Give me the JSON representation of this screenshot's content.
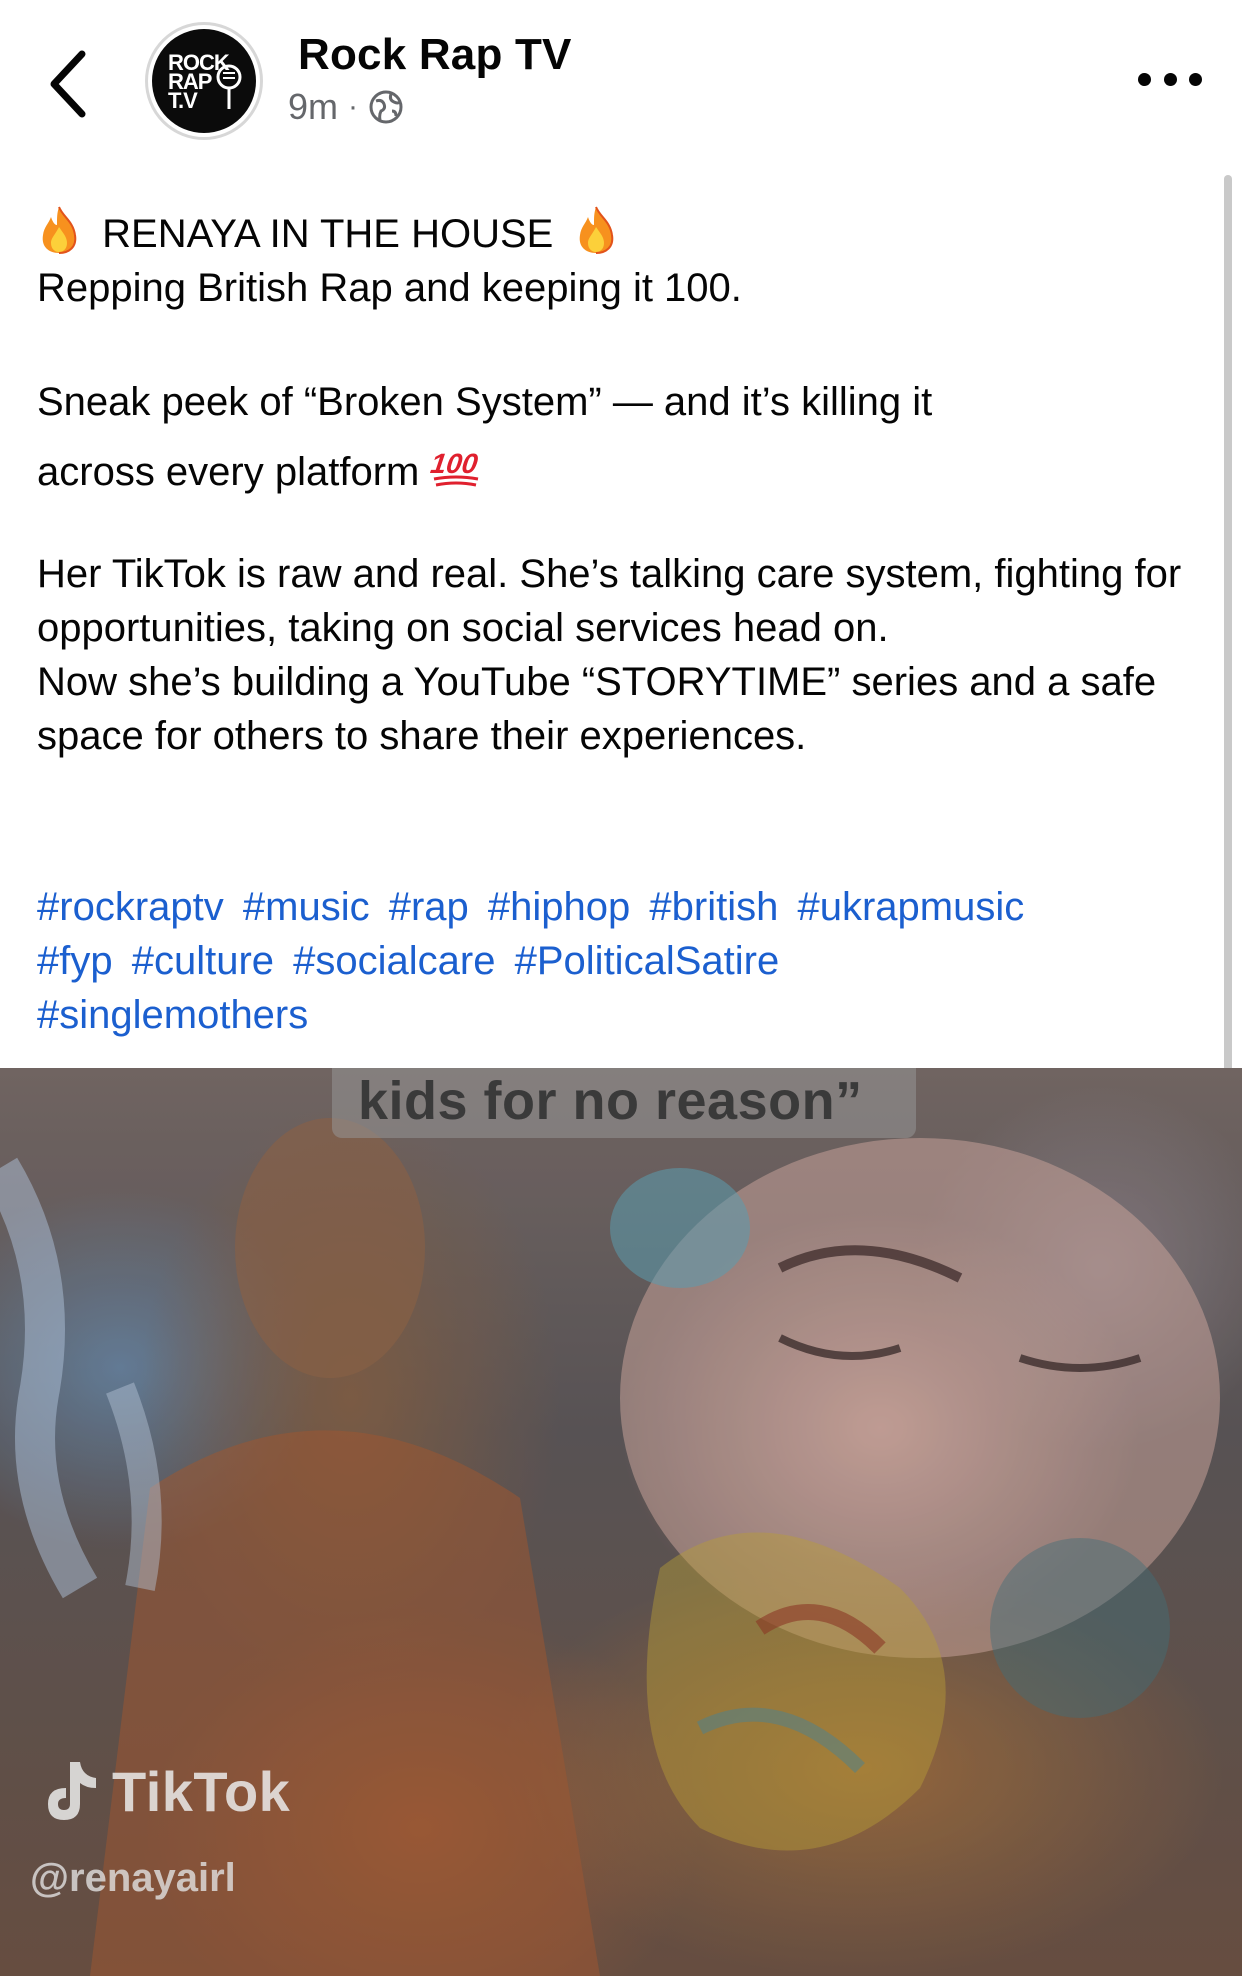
{
  "header": {
    "page_name": "Rock Rap TV",
    "time": "9m",
    "separator": "·",
    "avatar_lines": [
      "ROCK",
      "RAP",
      "T.V"
    ]
  },
  "post": {
    "line1": "RENAYA IN THE HOUSE",
    "line2": "Repping British Rap and keeping it 100.",
    "line3": "Sneak peek of “Broken System” — and it’s killing it",
    "line4": "across every platform",
    "line5": "Her TikTok is raw and real. She’s talking care system, fighting for opportunities, taking on social services head on.",
    "line6": "Now she’s building a YouTube “STORYTIME” series and a safe space for others to share their experiences."
  },
  "hashtags": [
    "#rockraptv",
    "#music",
    "#rap",
    "#hiphop",
    "#british",
    "#ukrapmusic",
    "#fyp",
    "#culture",
    "#socialcare",
    "#PoliticalSatire",
    "#singlemothers"
  ],
  "video": {
    "caption": "kids for no reason”",
    "watermark_brand": "TikTok",
    "watermark_handle": "@renayairl"
  },
  "colors": {
    "link": "#1b5fcf",
    "secondary_text": "#65676b"
  },
  "icons": [
    "back-chevron-icon",
    "globe-icon",
    "more-options-icon",
    "fire-emoji-icon",
    "hundred-points-emoji-icon",
    "tiktok-note-icon"
  ]
}
